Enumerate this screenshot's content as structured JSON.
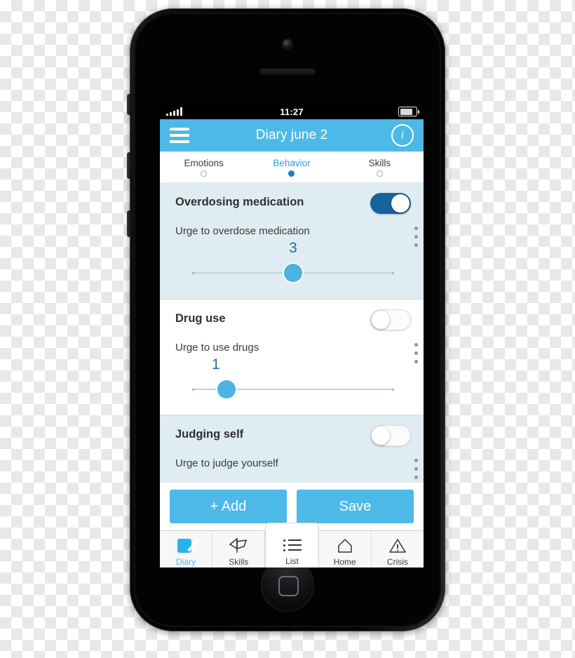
{
  "status_bar": {
    "time": "11:27",
    "signal_icon": "signal-bars-icon",
    "battery_icon": "battery-icon"
  },
  "nav": {
    "title": "Diary june 2",
    "menu_icon": "hamburger-menu-icon",
    "info_icon": "info-icon",
    "info_glyph": "i",
    "accent": "#4cb9e8"
  },
  "tabs": [
    {
      "label": "Emotions",
      "active": false
    },
    {
      "label": "Behavior",
      "active": true
    },
    {
      "label": "Skills",
      "active": false
    }
  ],
  "cards": [
    {
      "title": "Overdosing medication",
      "subtitle": "Urge to overdose medication",
      "value": "3",
      "toggle": "on",
      "slider_percent": 50,
      "menu_icon": "more-vertical-icon"
    },
    {
      "title": "Drug use",
      "subtitle": "Urge to use drugs",
      "value": "1",
      "toggle": "off",
      "slider_percent": 17,
      "menu_icon": "more-vertical-icon"
    },
    {
      "title": "Judging self",
      "subtitle": "Urge to judge yourself",
      "value": "",
      "toggle": "off",
      "slider_percent": null,
      "menu_icon": "more-vertical-icon"
    }
  ],
  "actions": {
    "add_label": "+ Add",
    "save_label": "Save"
  },
  "tabbar": [
    {
      "label": "Diary",
      "icon": "diary-pencil-icon",
      "active": true,
      "raised": false
    },
    {
      "label": "Skills",
      "icon": "flag-kite-icon",
      "active": false,
      "raised": false
    },
    {
      "label": "List",
      "icon": "bulleted-list-icon",
      "active": false,
      "raised": true
    },
    {
      "label": "Home",
      "icon": "house-icon",
      "active": false,
      "raised": false
    },
    {
      "label": "Crisis",
      "icon": "warning-triangle-icon",
      "active": false,
      "raised": false
    }
  ],
  "device": {
    "camera_icon": "front-camera-icon",
    "speaker_icon": "earpiece-speaker-icon",
    "home_button_icon": "home-button-icon",
    "mute_switch": "mute-switch",
    "volume_up": "volume-up-button",
    "volume_down": "volume-down-button"
  }
}
